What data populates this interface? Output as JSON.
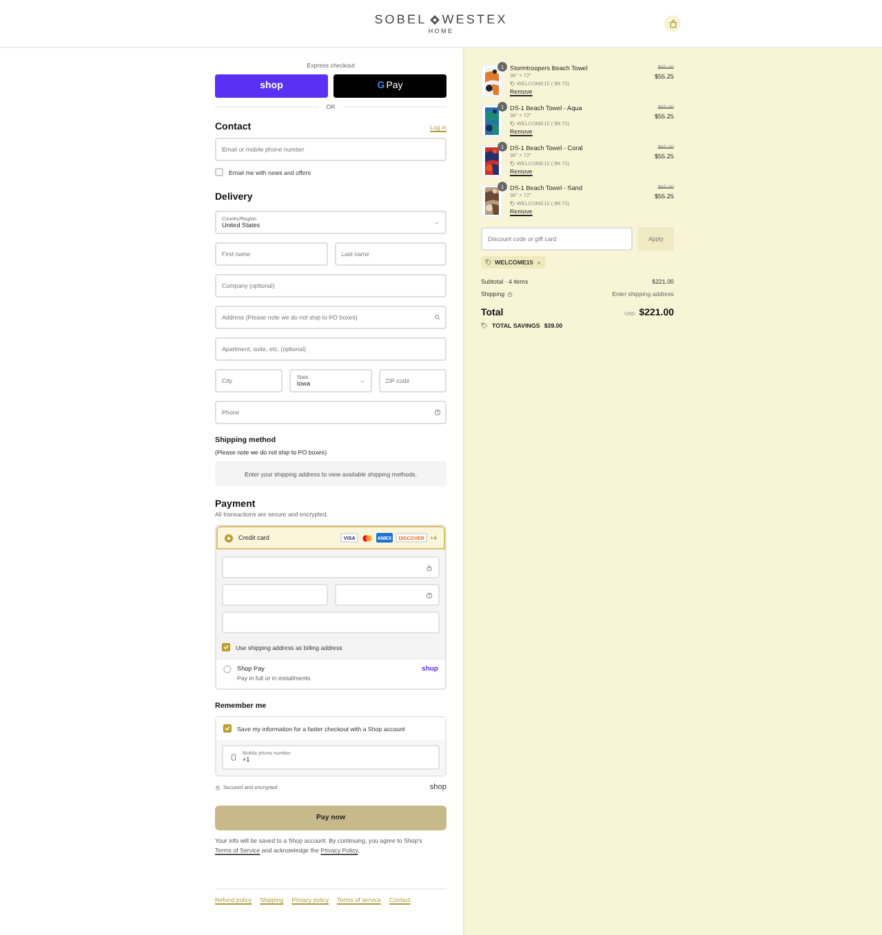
{
  "header": {
    "brand_left": "SOBEL",
    "brand_right": "WESTEX",
    "brand_sub": "HOME"
  },
  "express": {
    "title": "Express checkout",
    "divider": "OR",
    "buttons": [
      {
        "kind": "shop",
        "label": "shop"
      },
      {
        "kind": "gpay",
        "logo_letter": "G",
        "label": "Pay"
      }
    ]
  },
  "contact": {
    "title": "Contact",
    "link": "Log in",
    "email": {
      "placeholder": "Email or mobile phone number"
    },
    "newsletter": {
      "label": "Email me with news and offers",
      "checked": false
    }
  },
  "delivery": {
    "title": "Delivery",
    "rows": [
      [
        {
          "kind": "select",
          "label": "Country/Region",
          "value": "United States"
        }
      ],
      [
        {
          "kind": "input",
          "placeholder": "First name"
        },
        {
          "kind": "input",
          "placeholder": "Last name"
        }
      ],
      [
        {
          "kind": "input",
          "placeholder": "Company (optional)"
        }
      ],
      [
        {
          "kind": "search",
          "placeholder": "Address (Please note we do not ship to PO boxes)"
        }
      ],
      [
        {
          "kind": "input",
          "placeholder": "Apartment, suite, etc. (optional)"
        }
      ],
      [
        {
          "kind": "input",
          "placeholder": "City"
        },
        {
          "kind": "select",
          "label": "State",
          "value": "Iowa"
        },
        {
          "kind": "input",
          "placeholder": "ZIP code"
        }
      ],
      [
        {
          "kind": "help",
          "placeholder": "Phone"
        }
      ]
    ]
  },
  "shipping_method": {
    "title": "Shipping method",
    "note": "(Please note we do not ship to PO boxes)",
    "message": "Enter your shipping address to view available shipping methods."
  },
  "payment": {
    "title": "Payment",
    "subtitle": "All transactions are secure and encrypted.",
    "card": {
      "label": "Credit card",
      "selected": true,
      "brands": [
        {
          "kind": "visa",
          "label": "VISA"
        },
        {
          "kind": "mastercard"
        },
        {
          "kind": "amex",
          "label": "AMEX"
        },
        {
          "kind": "discover",
          "label": "DISCOVER"
        }
      ],
      "more": "+4"
    },
    "billing": {
      "label": "Use shipping address as billing address",
      "checked": true
    },
    "shop_pay": {
      "label": "Shop Pay",
      "sub": "Pay in full or in installments",
      "logo": "shop",
      "selected": false
    }
  },
  "remember": {
    "title": "Remember me",
    "save": {
      "label": "Save my information for a faster checkout with a Shop account",
      "checked": true
    },
    "phone": {
      "label": "Mobile phone number",
      "value": "+1"
    }
  },
  "secure": {
    "text": "Secured and encrypted",
    "logo": "shop"
  },
  "pay_button": "Pay now",
  "legal": [
    {
      "kind": "text",
      "text": "Your info will be saved to a Shop account. By continuing, you agree to Shop's "
    },
    {
      "kind": "link",
      "text": "Terms of Service"
    },
    {
      "kind": "text",
      "text": " and acknowledge the "
    },
    {
      "kind": "link",
      "text": "Privacy Policy"
    },
    {
      "kind": "text",
      "text": "."
    }
  ],
  "footer_links": [
    "Refund policy",
    "Shipping",
    "Privacy policy",
    "Terms of service",
    "Contact"
  ],
  "summary": {
    "items": [
      {
        "name": "Stormtroopers Beach Towel",
        "quantity": "1",
        "variant": "36\" × 72\"",
        "discount": "WELCOME15 (-$9.75)",
        "remove": "Remove",
        "original_price": "$65.00",
        "price": "$55.25"
      },
      {
        "name": "DS-1 Beach Towel - Aqua",
        "quantity": "1",
        "variant": "36\" × 72\"",
        "discount": "WELCOME15 (-$9.75)",
        "remove": "Remove",
        "original_price": "$65.00",
        "price": "$55.25"
      },
      {
        "name": "DS-1 Beach Towel - Coral",
        "quantity": "1",
        "variant": "36\" × 72\"",
        "discount": "WELCOME15 (-$9.75)",
        "remove": "Remove",
        "original_price": "$65.00",
        "price": "$55.25"
      },
      {
        "name": "DS-1 Beach Towel - Sand",
        "quantity": "1",
        "variant": "36\" × 72\"",
        "discount": "WELCOME15 (-$9.75)",
        "remove": "Remove",
        "original_price": "$65.00",
        "price": "$55.25"
      }
    ],
    "discount": {
      "placeholder": "Discount code or gift card",
      "button": "Apply"
    },
    "applied_code": "WELCOME15",
    "totals": {
      "subtotal_label": "Subtotal · 4 items",
      "subtotal": "$221.00",
      "shipping_label": "Shipping",
      "shipping": "Enter shipping address",
      "total_label": "Total",
      "currency": "USD",
      "total": "$221.00",
      "savings_label": "TOTAL SAVINGS",
      "savings": "$39.00"
    }
  }
}
